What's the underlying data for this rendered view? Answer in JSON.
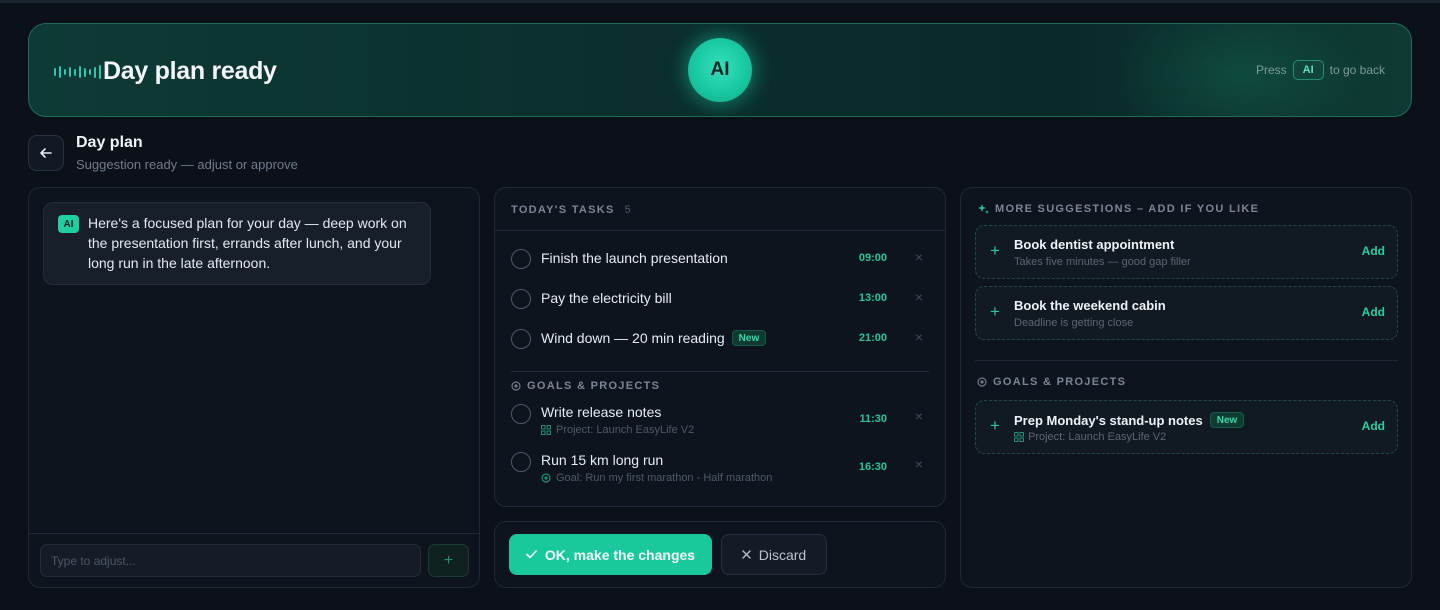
{
  "banner": {
    "title": "Day plan ready",
    "orb_label": "AI",
    "press_prefix": "Press",
    "press_key": "AI",
    "press_suffix": "to go back"
  },
  "header": {
    "title": "Day plan",
    "subtitle": "Suggestion ready — adjust or approve"
  },
  "chat": {
    "badge": "AI",
    "message": "Here's a focused plan for your day — deep work on the presentation first, errands after lunch, and your long run in the late afternoon.",
    "input_placeholder": "Type to adjust...",
    "send_icon": "+"
  },
  "tasks": {
    "heading": "TODAY'S TASKS",
    "count": "5",
    "items": [
      {
        "label": "Finish the launch presentation",
        "time": "09:00"
      },
      {
        "label": "Pay the electricity bill",
        "time": "13:00"
      },
      {
        "label": "Wind down — 20 min reading",
        "time": "21:00",
        "tag": "New"
      }
    ],
    "goals_heading": "GOALS & PROJECTS",
    "goal_items": [
      {
        "label": "Write release notes",
        "time": "11:30",
        "sub": "Project: Launch EasyLife V2",
        "sub_icon": "grid-icon"
      },
      {
        "label": "Run 15 km long run",
        "time": "16:30",
        "sub": "Goal: Run my first marathon - Half marathon",
        "sub_icon": "target-icon"
      }
    ],
    "remove_glyph": "×"
  },
  "actions": {
    "ok_label": "OK, make the changes",
    "discard_label": "Discard"
  },
  "suggestions": {
    "heading": "MORE SUGGESTIONS – ADD IF YOU LIKE",
    "items": [
      {
        "title": "Book dentist appointment",
        "sub": "Takes five minutes — good gap filler",
        "add": "Add"
      },
      {
        "title": "Book the weekend cabin",
        "sub": "Deadline is getting close",
        "add": "Add"
      }
    ],
    "goals_heading": "GOALS & PROJECTS",
    "goal_items": [
      {
        "title": "Prep Monday's stand-up notes",
        "tag": "New",
        "sub": "Project: Launch EasyLife V2",
        "add": "Add"
      }
    ]
  },
  "colors": {
    "accent": "#19c99b",
    "background": "#0b1019",
    "panel": "#0e141e"
  }
}
